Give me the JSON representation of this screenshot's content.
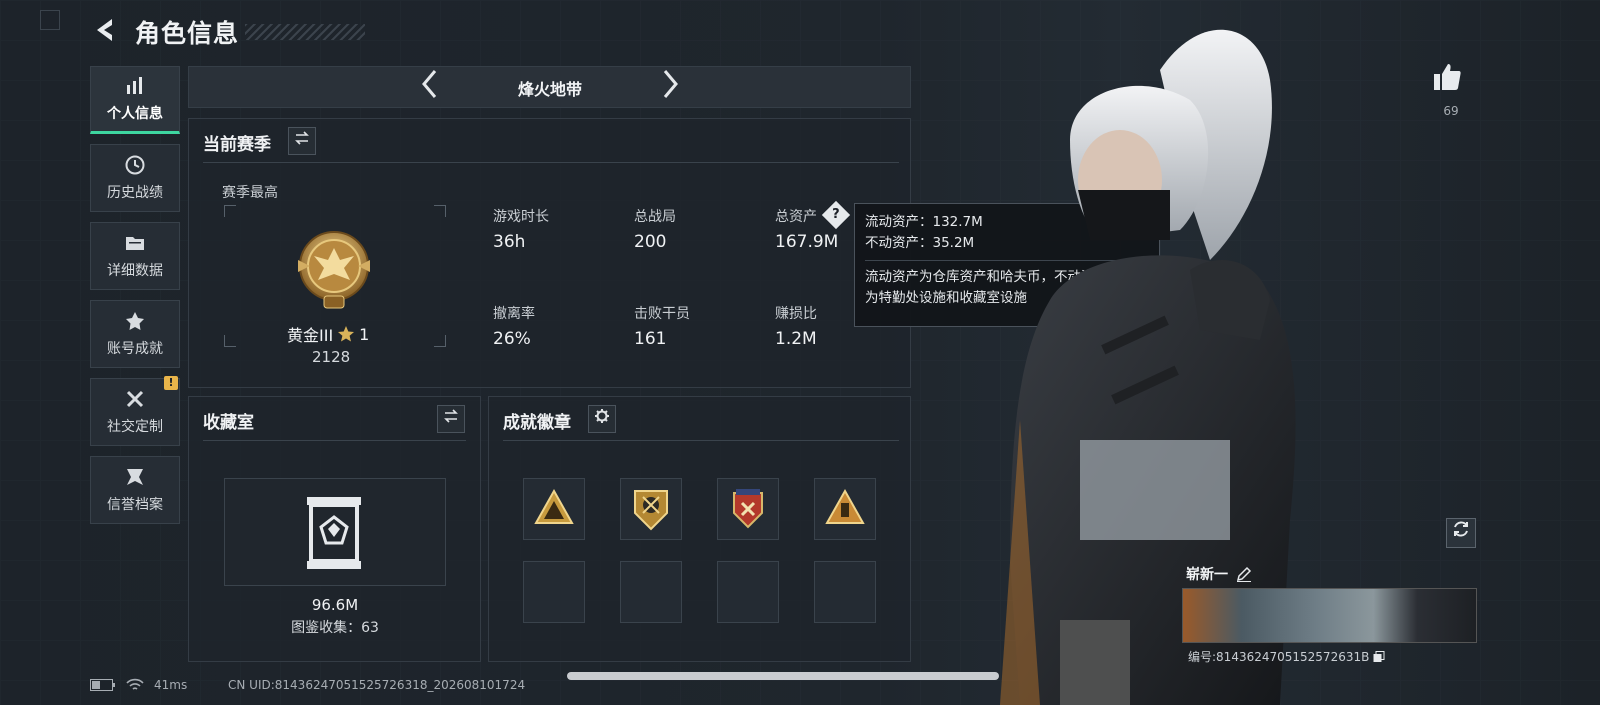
{
  "header": {
    "title": "角色信息"
  },
  "sidebar": {
    "items": [
      {
        "label": "个人信息",
        "icon": "bar-chart-icon",
        "active": true
      },
      {
        "label": "历史战绩",
        "icon": "history-icon"
      },
      {
        "label": "详细数据",
        "icon": "folder-icon"
      },
      {
        "label": "账号成就",
        "icon": "medal-icon"
      },
      {
        "label": "社交定制",
        "icon": "tools-icon",
        "alert": "!"
      },
      {
        "label": "信誉档案",
        "icon": "shield-icon"
      }
    ]
  },
  "mode_selector": {
    "label": "烽火地带"
  },
  "season": {
    "title": "当前赛季",
    "highest_label": "赛季最高",
    "rank_name": "黄金III",
    "rank_stars": "1",
    "rank_points": "2128",
    "stats": [
      {
        "label": "游戏时长",
        "value": "36h"
      },
      {
        "label": "总战局",
        "value": "200"
      },
      {
        "label": "总资产",
        "value": "167.9M",
        "help_icon": "question-icon"
      },
      {
        "label": "撤离率",
        "value": "26%"
      },
      {
        "label": "击败干员",
        "value": "161"
      },
      {
        "label": "赚损比",
        "value": "1.2M"
      }
    ]
  },
  "tooltip": {
    "liquid": "流动资产：132.7M",
    "fixed": "不动资产：35.2M",
    "note_line1": "流动资产为仓库资产和哈夫币，不动资产",
    "note_line2": "为特勤处设施和收藏室设施"
  },
  "collection": {
    "title": "收藏室",
    "value": "96.6M",
    "count_text": "图鉴收集：63"
  },
  "achievements": {
    "title": "成就徽章",
    "badges": [
      "triangle-badge",
      "shield-crest-badge",
      "red-shield-badge",
      "triangle-figure-badge"
    ]
  },
  "profile": {
    "likes": "69",
    "player_name": "崭新一",
    "player_id": "编号:8143624705152572631B"
  },
  "status_bar": {
    "ping": "41ms",
    "uid": "CN UID:81436247051525726318_202608101724"
  },
  "colors": {
    "accent": "#3ed6a0",
    "alert": "#e9b54a",
    "rank_gold": "#c9a050"
  }
}
